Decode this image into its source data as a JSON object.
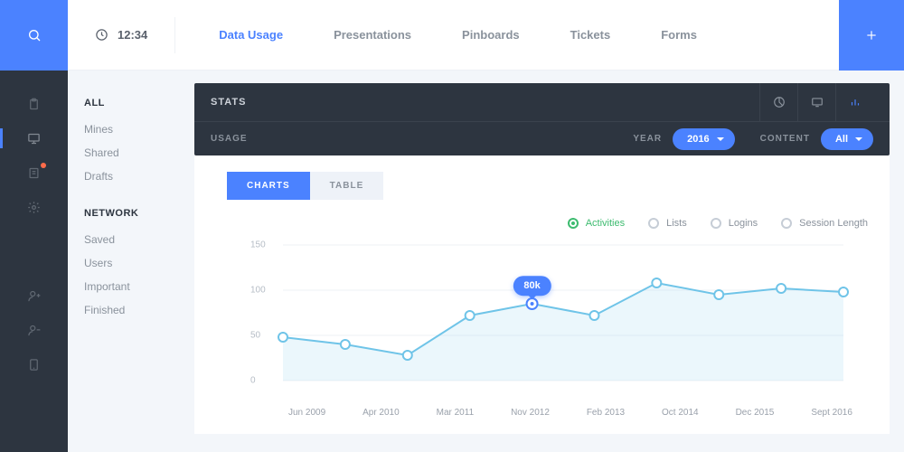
{
  "clock": {
    "time": "12:34"
  },
  "nav": {
    "tabs": [
      "Data Usage",
      "Presentations",
      "Pinboards",
      "Tickets",
      "Forms"
    ],
    "active_index": 0
  },
  "sidebar": {
    "section1": {
      "title": "ALL",
      "items": [
        "Mines",
        "Shared",
        "Drafts"
      ]
    },
    "section2": {
      "title": "NETWORK",
      "items": [
        "Saved",
        "Users",
        "Important",
        "Finished"
      ]
    }
  },
  "stats": {
    "title": "STATS",
    "filter": {
      "label": "USAGE",
      "year_label": "YEAR",
      "year_value": "2016",
      "content_label": "CONTENT",
      "content_value": "All"
    },
    "view": {
      "charts": "CHARTS",
      "table": "TABLE",
      "active": "charts"
    }
  },
  "legend": {
    "items": [
      "Activities",
      "Lists",
      "Logins",
      "Session Length"
    ],
    "active_index": 0
  },
  "tooltip": {
    "value": "80k"
  },
  "chart_data": {
    "type": "area",
    "title": "",
    "xlabel": "",
    "ylabel": "",
    "ylim": [
      0,
      150
    ],
    "yticks": [
      0,
      50,
      100,
      150
    ],
    "categories": [
      "Jun 2009",
      "Apr 2010",
      "Mar 2011",
      "Nov 2012",
      "Feb 2013",
      "Oct 2014",
      "Dec 2015",
      "Sept 2016"
    ],
    "series": [
      {
        "name": "Activities",
        "values": [
          48,
          40,
          28,
          72,
          85,
          72,
          108,
          95,
          102,
          98
        ]
      }
    ],
    "highlight_index": 4
  },
  "colors": {
    "primary": "#4b82ff",
    "rail": "#2d3540",
    "line": "#6fc4e8",
    "success": "#3dbb6f"
  }
}
